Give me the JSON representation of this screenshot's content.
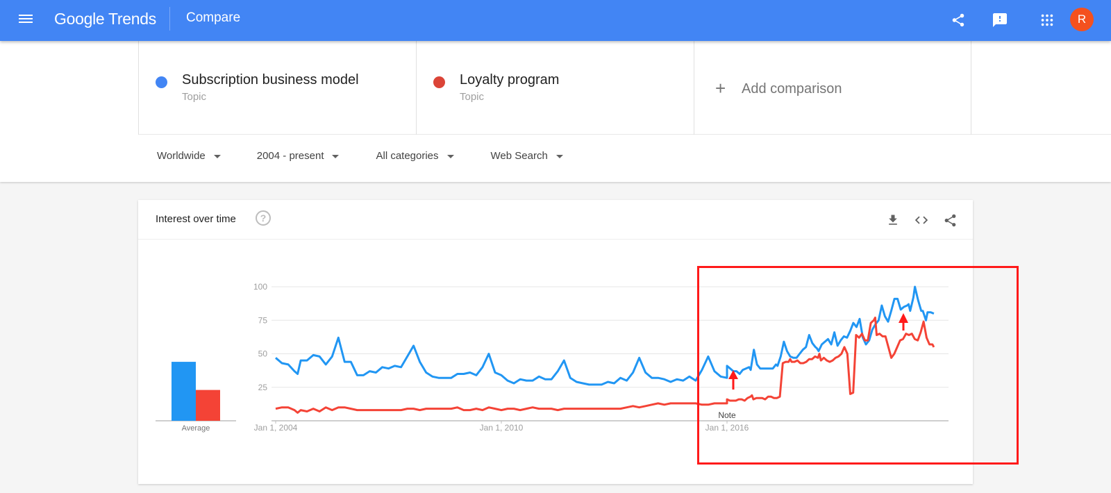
{
  "header": {
    "app_name": "Google Trends",
    "page_title": "Compare",
    "avatar_initial": "R",
    "icons": [
      "menu-icon",
      "share-icon",
      "feedback-icon",
      "apps-icon"
    ]
  },
  "terms": [
    {
      "name": "Subscription business model",
      "type": "Topic",
      "color": "#4285f4"
    },
    {
      "name": "Loyalty program",
      "type": "Topic",
      "color": "#db4437"
    }
  ],
  "add_comparison": {
    "icon": "+",
    "label": "Add comparison"
  },
  "filters": [
    {
      "label": "Worldwide"
    },
    {
      "label": "2004 - present"
    },
    {
      "label": "All categories"
    },
    {
      "label": "Web Search"
    }
  ],
  "interest_card": {
    "title": "Interest over time",
    "help": "?",
    "actions": [
      "download-icon",
      "embed-icon",
      "share-icon"
    ],
    "average_label": "Average",
    "note_label": "Note"
  },
  "colors": {
    "brand": "#4285f4",
    "series1": "#2196f3",
    "series2": "#f44336",
    "annotation": "#ff1a1a",
    "avatar": "#f4511e"
  },
  "chart_data": {
    "type": "line",
    "title": "Interest over time",
    "xlabel": "",
    "ylabel": "",
    "ylim": [
      0,
      100
    ],
    "y_ticks": [
      25,
      50,
      75,
      100
    ],
    "x_tick_labels": [
      "Jan 1, 2004",
      "Jan 1, 2010",
      "Jan 1, 2016"
    ],
    "x_tick_months": [
      0,
      72,
      144
    ],
    "start": "2004-01",
    "frequency": "monthly",
    "grid": true,
    "legend": "none",
    "annotations": [
      {
        "label": "Note",
        "month": 144
      }
    ],
    "averages": {
      "Subscription business model": 44,
      "Loyalty program": 23
    },
    "series": [
      {
        "name": "Subscription business model",
        "keypoints": [
          [
            0,
            47
          ],
          [
            2,
            43
          ],
          [
            4,
            42
          ],
          [
            6,
            37
          ],
          [
            7,
            35
          ],
          [
            8,
            45
          ],
          [
            10,
            45
          ],
          [
            12,
            49
          ],
          [
            14,
            48
          ],
          [
            16,
            42
          ],
          [
            18,
            48
          ],
          [
            20,
            62
          ],
          [
            22,
            44
          ],
          [
            24,
            44
          ],
          [
            26,
            34
          ],
          [
            28,
            34
          ],
          [
            30,
            37
          ],
          [
            32,
            36
          ],
          [
            34,
            40
          ],
          [
            36,
            39
          ],
          [
            38,
            41
          ],
          [
            40,
            40
          ],
          [
            42,
            48
          ],
          [
            44,
            56
          ],
          [
            46,
            44
          ],
          [
            48,
            36
          ],
          [
            50,
            33
          ],
          [
            52,
            32
          ],
          [
            56,
            32
          ],
          [
            58,
            35
          ],
          [
            60,
            35
          ],
          [
            62,
            36
          ],
          [
            64,
            34
          ],
          [
            66,
            40
          ],
          [
            68,
            50
          ],
          [
            70,
            36
          ],
          [
            72,
            34
          ],
          [
            74,
            30
          ],
          [
            76,
            28
          ],
          [
            78,
            31
          ],
          [
            80,
            30
          ],
          [
            82,
            30
          ],
          [
            84,
            33
          ],
          [
            86,
            31
          ],
          [
            88,
            31
          ],
          [
            90,
            37
          ],
          [
            92,
            45
          ],
          [
            94,
            32
          ],
          [
            96,
            29
          ],
          [
            98,
            28
          ],
          [
            100,
            27
          ],
          [
            104,
            27
          ],
          [
            106,
            29
          ],
          [
            108,
            28
          ],
          [
            110,
            32
          ],
          [
            112,
            30
          ],
          [
            114,
            36
          ],
          [
            116,
            47
          ],
          [
            118,
            36
          ],
          [
            120,
            32
          ],
          [
            122,
            32
          ],
          [
            124,
            31
          ],
          [
            126,
            29
          ],
          [
            128,
            31
          ],
          [
            130,
            30
          ],
          [
            132,
            33
          ],
          [
            134,
            30
          ],
          [
            136,
            38
          ],
          [
            138,
            48
          ],
          [
            140,
            37
          ],
          [
            142,
            33
          ],
          [
            144,
            32
          ],
          [
            146,
            31
          ],
          [
            148,
            30
          ],
          [
            150,
            33
          ],
          [
            152,
            31
          ],
          [
            154,
            32
          ],
          [
            156,
            31
          ],
          [
            158,
            35
          ],
          [
            160,
            35
          ],
          [
            162,
            33
          ],
          [
            164,
            36
          ],
          [
            166,
            46
          ],
          [
            168,
            38
          ],
          [
            170,
            35
          ],
          [
            172,
            35
          ],
          [
            174,
            34
          ],
          [
            176,
            37
          ],
          [
            178,
            36
          ],
          [
            180,
            38
          ],
          [
            182,
            37
          ],
          [
            184,
            38
          ],
          [
            186,
            37
          ],
          [
            188,
            40
          ],
          [
            190,
            48
          ],
          [
            192,
            40
          ],
          [
            194,
            37
          ],
          [
            196,
            36
          ],
          [
            198,
            35
          ],
          [
            200,
            33
          ],
          [
            202,
            35
          ],
          [
            204,
            38
          ],
          [
            206,
            38
          ],
          [
            208,
            39
          ],
          [
            210,
            38
          ]
        ],
        "tail": [
          [
            144,
            41
          ],
          [
            146,
            39
          ],
          [
            148,
            37
          ],
          [
            150,
            37
          ],
          [
            152,
            35
          ],
          [
            154,
            38
          ],
          [
            156,
            39
          ],
          [
            158,
            40
          ],
          [
            159,
            38
          ],
          [
            161,
            53
          ],
          [
            163,
            42
          ],
          [
            165,
            39
          ],
          [
            167,
            39
          ],
          [
            173,
            39
          ],
          [
            175,
            42
          ],
          [
            176,
            41
          ],
          [
            178,
            48
          ],
          [
            180,
            59
          ],
          [
            182,
            52
          ],
          [
            184,
            48
          ],
          [
            186,
            47
          ],
          [
            188,
            47
          ],
          [
            190,
            50
          ],
          [
            192,
            53
          ],
          [
            194,
            55
          ],
          [
            196,
            64
          ],
          [
            198,
            58
          ],
          [
            200,
            55
          ],
          [
            201,
            54
          ],
          [
            202,
            52
          ],
          [
            204,
            57
          ],
          [
            206,
            59
          ],
          [
            208,
            61
          ],
          [
            210,
            57
          ],
          [
            212,
            66
          ],
          [
            214,
            56
          ],
          [
            216,
            60
          ],
          [
            218,
            63
          ],
          [
            220,
            62
          ],
          [
            222,
            67
          ],
          [
            224,
            73
          ],
          [
            226,
            70
          ],
          [
            228,
            76
          ],
          [
            230,
            62
          ],
          [
            232,
            57
          ],
          [
            234,
            60
          ],
          [
            236,
            68
          ],
          [
            238,
            72
          ],
          [
            240,
            75
          ],
          [
            242,
            86
          ],
          [
            244,
            78
          ],
          [
            246,
            74
          ],
          [
            248,
            82
          ],
          [
            250,
            91
          ],
          [
            252,
            91
          ],
          [
            254,
            83
          ],
          [
            256,
            85
          ],
          [
            258,
            86
          ],
          [
            259,
            87
          ],
          [
            260,
            82
          ],
          [
            262,
            92
          ],
          [
            263,
            100
          ],
          [
            265,
            90
          ],
          [
            267,
            82
          ],
          [
            268,
            82
          ],
          [
            270,
            75
          ],
          [
            271,
            81
          ],
          [
            273,
            81
          ],
          [
            275,
            80
          ]
        ]
      },
      {
        "name": "Loyalty program",
        "keypoints": [
          [
            0,
            9
          ],
          [
            2,
            10
          ],
          [
            4,
            10
          ],
          [
            6,
            8
          ],
          [
            7,
            6
          ],
          [
            8,
            8
          ],
          [
            10,
            7
          ],
          [
            12,
            9
          ],
          [
            14,
            7
          ],
          [
            16,
            10
          ],
          [
            18,
            8
          ],
          [
            20,
            10
          ],
          [
            22,
            10
          ],
          [
            24,
            9
          ],
          [
            26,
            8
          ],
          [
            30,
            8
          ],
          [
            40,
            8
          ],
          [
            42,
            9
          ],
          [
            44,
            9
          ],
          [
            46,
            8
          ],
          [
            48,
            9
          ],
          [
            56,
            9
          ],
          [
            58,
            10
          ],
          [
            60,
            8
          ],
          [
            62,
            8
          ],
          [
            64,
            9
          ],
          [
            66,
            8
          ],
          [
            68,
            10
          ],
          [
            70,
            9
          ],
          [
            72,
            8
          ],
          [
            74,
            9
          ],
          [
            76,
            9
          ],
          [
            78,
            8
          ],
          [
            80,
            9
          ],
          [
            82,
            10
          ],
          [
            84,
            9
          ],
          [
            88,
            9
          ],
          [
            90,
            8
          ],
          [
            92,
            9
          ],
          [
            110,
            9
          ],
          [
            112,
            10
          ],
          [
            114,
            11
          ],
          [
            116,
            10
          ],
          [
            118,
            11
          ],
          [
            120,
            12
          ],
          [
            122,
            13
          ],
          [
            124,
            12
          ],
          [
            126,
            13
          ],
          [
            128,
            13
          ],
          [
            134,
            13
          ],
          [
            136,
            12
          ],
          [
            138,
            12
          ],
          [
            140,
            13
          ],
          [
            142,
            13
          ],
          [
            144,
            13
          ]
        ],
        "tail": [
          [
            144,
            16
          ],
          [
            146,
            15
          ],
          [
            148,
            15
          ],
          [
            150,
            15
          ],
          [
            152,
            16
          ],
          [
            154,
            16
          ],
          [
            156,
            15
          ],
          [
            158,
            17
          ],
          [
            160,
            18
          ],
          [
            161,
            19
          ],
          [
            162,
            16
          ],
          [
            164,
            17
          ],
          [
            168,
            17
          ],
          [
            170,
            16
          ],
          [
            172,
            18
          ],
          [
            174,
            18
          ],
          [
            176,
            17
          ],
          [
            178,
            17
          ],
          [
            180,
            18
          ],
          [
            182,
            43
          ],
          [
            184,
            44
          ],
          [
            186,
            44
          ],
          [
            187,
            46
          ],
          [
            188,
            44
          ],
          [
            190,
            44
          ],
          [
            192,
            45
          ],
          [
            194,
            43
          ],
          [
            196,
            43
          ],
          [
            198,
            44
          ],
          [
            200,
            46
          ],
          [
            202,
            46
          ],
          [
            204,
            48
          ],
          [
            206,
            47
          ],
          [
            207,
            50
          ],
          [
            208,
            45
          ],
          [
            210,
            47
          ],
          [
            212,
            45
          ],
          [
            214,
            44
          ],
          [
            216,
            45
          ],
          [
            218,
            47
          ],
          [
            220,
            48
          ],
          [
            222,
            50
          ],
          [
            224,
            55
          ],
          [
            226,
            50
          ],
          [
            228,
            20
          ],
          [
            230,
            21
          ],
          [
            232,
            64
          ],
          [
            234,
            62
          ],
          [
            236,
            65
          ],
          [
            238,
            60
          ],
          [
            240,
            60
          ],
          [
            242,
            73
          ],
          [
            244,
            75
          ],
          [
            245,
            77
          ],
          [
            246,
            64
          ],
          [
            248,
            65
          ],
          [
            250,
            63
          ],
          [
            252,
            63
          ],
          [
            254,
            55
          ],
          [
            256,
            47
          ],
          [
            258,
            50
          ],
          [
            260,
            55
          ],
          [
            262,
            60
          ],
          [
            264,
            61
          ],
          [
            266,
            65
          ],
          [
            268,
            64
          ],
          [
            270,
            65
          ],
          [
            272,
            61
          ],
          [
            274,
            60
          ],
          [
            276,
            66
          ],
          [
            278,
            74
          ],
          [
            280,
            62
          ],
          [
            282,
            57
          ],
          [
            284,
            57
          ],
          [
            285,
            55
          ]
        ]
      }
    ]
  }
}
